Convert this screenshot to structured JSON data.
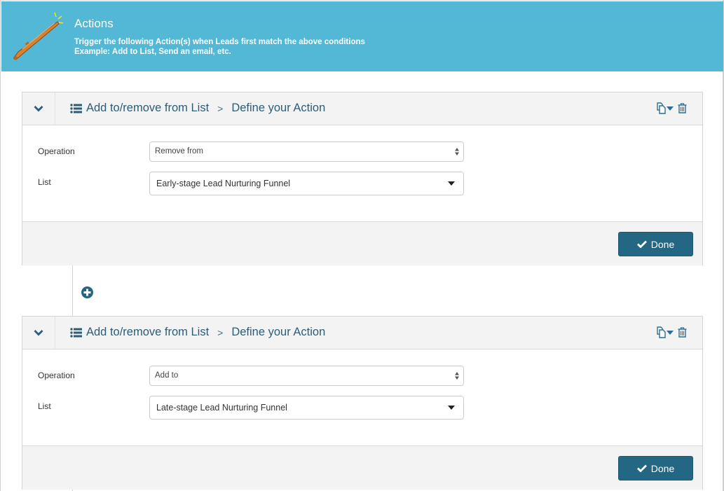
{
  "header": {
    "icon": "magic-wand-icon",
    "title": "Actions",
    "description": "Trigger the following Action(s) when Leads first match the above conditions",
    "example": "Example: Add to List, Send an email, etc."
  },
  "colors": {
    "header_bg": "#53b8d6",
    "primary": "#236785",
    "breadcrumb_text": "#2b5d7a",
    "panel_bg": "#f3f3f3"
  },
  "actions": [
    {
      "breadcrumb": {
        "icon": "list-icon",
        "type": "Add to/remove from List",
        "separator": ">",
        "step": "Define your Action"
      },
      "tools": {
        "copy_icon": "copy-icon",
        "dropdown_icon": "caret-down-icon",
        "delete_icon": "trash-icon"
      },
      "fields": {
        "operation_label": "Operation",
        "operation_value": "Remove from",
        "list_label": "List",
        "list_value": "Early-stage Lead Nurturing Funnel"
      },
      "done_label": "Done"
    },
    {
      "breadcrumb": {
        "icon": "list-icon",
        "type": "Add to/remove from List",
        "separator": ">",
        "step": "Define your Action"
      },
      "tools": {
        "copy_icon": "copy-icon",
        "dropdown_icon": "caret-down-icon",
        "delete_icon": "trash-icon"
      },
      "fields": {
        "operation_label": "Operation",
        "operation_value": "Add to",
        "list_label": "List",
        "list_value": "Late-stage Lead Nurturing Funnel"
      },
      "done_label": "Done"
    }
  ],
  "add_action": {
    "icon": "plus-circle-icon"
  }
}
